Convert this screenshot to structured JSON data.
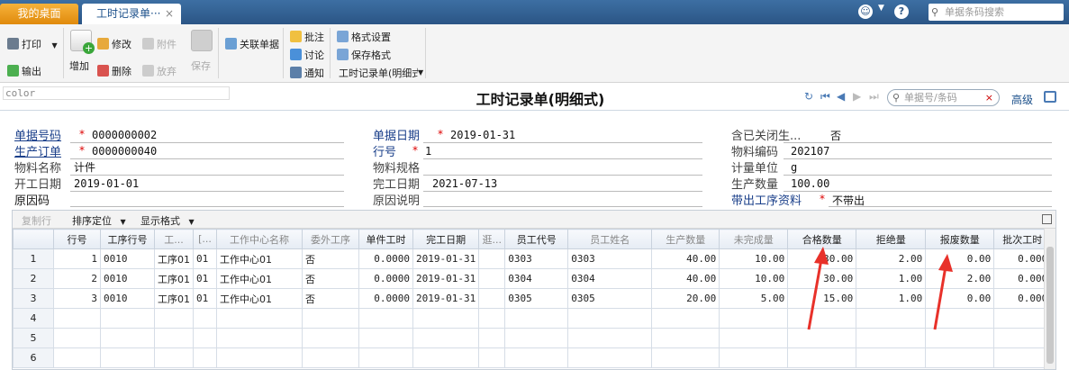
{
  "tabs": {
    "home": "我的桌面",
    "active": "工时记录单···",
    "close": "×"
  },
  "topbar": {
    "search_placeholder": "单据条码搜索",
    "smile_icon": "smile-icon",
    "help_icon": "help-icon"
  },
  "toolbar": {
    "print": "打印",
    "export": "输出",
    "add": "增加",
    "edit": "修改",
    "delete": "删除",
    "attach": "附件",
    "abandon": "放弃",
    "save": "保存",
    "related": "关联单据",
    "annotate": "批注",
    "discuss": "讨论",
    "notify": "通知",
    "format_settings": "格式设置",
    "save_format": "保存格式",
    "format_select": "工时记录单(明细式)"
  },
  "header": {
    "color_label": "color",
    "title": "工时记录单(明细式)",
    "doc_search_placeholder": "单据号/条码",
    "doc_search_clear": "×",
    "advanced": "高级"
  },
  "form": {
    "doc_no_label": "单据号码",
    "doc_no": "0000000002",
    "prod_order_label": "生产订单",
    "prod_order": "0000000040",
    "material_name_label": "物料名称",
    "material_name": "计件",
    "start_date_label": "开工日期",
    "start_date": "2019-01-01",
    "reason_label": "原因码",
    "doc_date_label": "单据日期",
    "doc_date": "2019-01-31",
    "line_no_label": "行号",
    "line_no": "1",
    "material_spec_label": "物料规格",
    "material_spec": "",
    "finish_date_label": "完工日期",
    "finish_date": "2021-07-13",
    "reason_desc_label": "原因说明",
    "reason_desc": "",
    "include_closed_label": "含已关闭生...",
    "include_closed": "否",
    "material_code_label": "物料编码",
    "material_code": "202107",
    "unit_label": "计量单位",
    "unit": "g",
    "prod_qty_label": "生产数量",
    "prod_qty": "100.00",
    "bring_process_label": "带出工序资料",
    "bring_process": "不带出"
  },
  "grid": {
    "toolbar": {
      "copy_row": "复制行",
      "sort_locate": "排序定位",
      "display_format": "显示格式"
    },
    "columns": [
      "",
      "行号",
      "工序行号",
      "工...",
      "[...",
      "工作中心名称",
      "委外工序",
      "单件工时",
      "完工日期",
      "逛...",
      "员工代号",
      "员工姓名",
      "生产数量",
      "未完成量",
      "合格数量",
      "拒绝量",
      "报废数量",
      "批次工时"
    ],
    "rows": [
      {
        "rn": "1",
        "line": "1",
        "proc_line": "0010",
        "proc": "工序01",
        "c": "01",
        "wc": "工作中心01",
        "outsource": "否",
        "unit_hours": "0.0000",
        "finish": "2019-01-31",
        "x": "",
        "emp_code": "0303",
        "emp_name": "0303",
        "prod_qty": "40.00",
        "unfinished": "10.00",
        "qualified": "30.00",
        "rejected": "2.00",
        "scrap": "0.00",
        "batch_hours": "0.000"
      },
      {
        "rn": "2",
        "line": "2",
        "proc_line": "0010",
        "proc": "工序01",
        "c": "01",
        "wc": "工作中心01",
        "outsource": "否",
        "unit_hours": "0.0000",
        "finish": "2019-01-31",
        "x": "",
        "emp_code": "0304",
        "emp_name": "0304",
        "prod_qty": "40.00",
        "unfinished": "10.00",
        "qualified": "30.00",
        "rejected": "1.00",
        "scrap": "2.00",
        "batch_hours": "0.000"
      },
      {
        "rn": "3",
        "line": "3",
        "proc_line": "0010",
        "proc": "工序01",
        "c": "01",
        "wc": "工作中心01",
        "outsource": "否",
        "unit_hours": "0.0000",
        "finish": "2019-01-31",
        "x": "",
        "emp_code": "0305",
        "emp_name": "0305",
        "prod_qty": "20.00",
        "unfinished": "5.00",
        "qualified": "15.00",
        "rejected": "1.00",
        "scrap": "0.00",
        "batch_hours": "0.000"
      }
    ],
    "empty_rows": [
      "4",
      "5",
      "6"
    ]
  },
  "colors": {
    "topbar": "#2b5585",
    "home_tab": "#f0a020",
    "link_blue": "#1a3f8a",
    "required": "#dd0000",
    "annotation_arrow": "#e8312a"
  }
}
